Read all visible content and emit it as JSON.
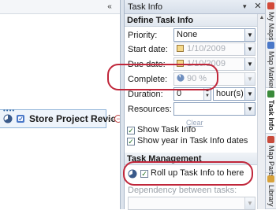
{
  "map": {
    "topic_label": "Store Project Review",
    "collapse_glyph": "«",
    "expand_glyph": "−",
    "topic_dots": "••••"
  },
  "pane": {
    "title": "Task Info",
    "header_glyph": "▾",
    "close_glyph": "✕",
    "section_define": "Define Task Info",
    "priority_label": "Priority:",
    "priority_value": "None",
    "start_label": "Start date:",
    "start_value": "1/10/2009",
    "due_label": "Due date:",
    "due_value": "1/10/2009",
    "complete_label": "Complete:",
    "complete_value": "90 %",
    "complete_fraction": 0.9,
    "duration_label": "Duration:",
    "duration_value": "0",
    "duration_unit": "hour(s)",
    "resources_label": "Resources:",
    "resources_value": "",
    "clear_link": "Clear",
    "show_task_info": "Show Task Info",
    "show_task_info_checked": true,
    "show_year": "Show year in Task Info dates",
    "show_year_checked": true,
    "section_management": "Task Management",
    "rollup_label": "Roll up Task Info to here",
    "rollup_checked": true,
    "dependency_label": "Dependency between tasks:",
    "dropdown_glyph": "▼",
    "check_glyph": "✓",
    "spin_up_glyph": "▲",
    "spin_down_glyph": "▼",
    "scroll_up_glyph": "▲"
  },
  "tabs": [
    {
      "label": "My Maps",
      "icon": "my-maps-icon",
      "color": "#d24a3a"
    },
    {
      "label": "Map Markers",
      "icon": "map-markers-icon",
      "color": "#4a78c8"
    },
    {
      "label": "Task Info",
      "icon": "task-info-icon",
      "color": "#3a8a3a",
      "active": true
    },
    {
      "label": "Map Parts",
      "icon": "map-parts-icon",
      "color": "#c84a3a"
    },
    {
      "label": "Library",
      "icon": "library-icon",
      "color": "#d8a23a"
    }
  ],
  "colors": {
    "highlight_oval": "#c0263a",
    "accent_blue": "#3a6ea8"
  }
}
